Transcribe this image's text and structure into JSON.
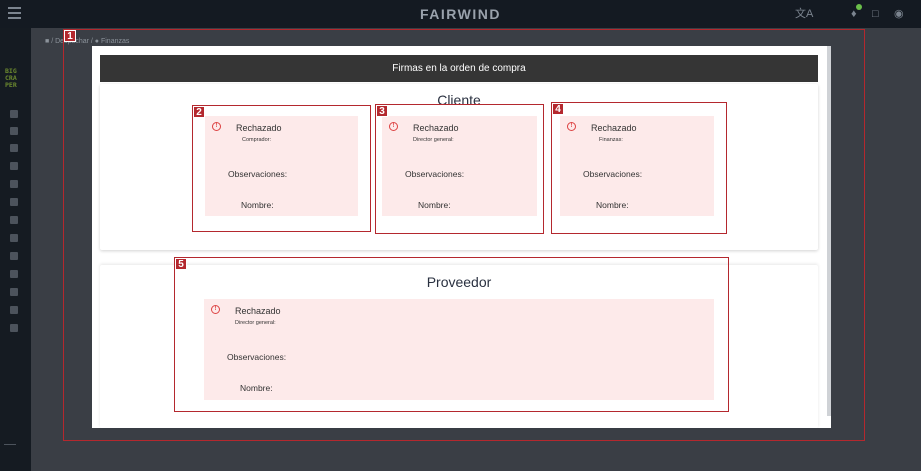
{
  "app": {
    "brand": "FAIRWIND"
  },
  "topbar": {
    "translate_icon": "translate-icon",
    "notification_icon": "bell-icon",
    "chat_icon": "chat-icon",
    "user_icon": "user-icon"
  },
  "sidebar": {
    "logo_lines": [
      "BIG",
      "CRA",
      "PER"
    ]
  },
  "breadcrumb": {
    "items": [
      "",
      "Despachar",
      "Finanzas"
    ]
  },
  "modal": {
    "title": "Firmas en la orden de compra",
    "cliente": {
      "title": "Cliente",
      "signatures": [
        {
          "status": "Rechazado",
          "role": "Comprador:",
          "obs_label": "Observaciones:",
          "name_label": "Nombre:"
        },
        {
          "status": "Rechazado",
          "role": "Director general:",
          "obs_label": "Observaciones:",
          "name_label": "Nombre:"
        },
        {
          "status": "Rechazado",
          "role": "Finanzas:",
          "obs_label": "Observaciones:",
          "name_label": "Nombre:"
        }
      ]
    },
    "proveedor": {
      "title": "Proveedor",
      "signature": {
        "status": "Rechazado",
        "role": "Director general:",
        "obs_label": "Observaciones:",
        "name_label": "Nombre:"
      }
    }
  },
  "annotations": [
    "1",
    "2",
    "3",
    "4",
    "5"
  ],
  "colors": {
    "accent": "#b4282e",
    "rejected_bg": "#fdeaea",
    "header_bg": "#353535"
  }
}
